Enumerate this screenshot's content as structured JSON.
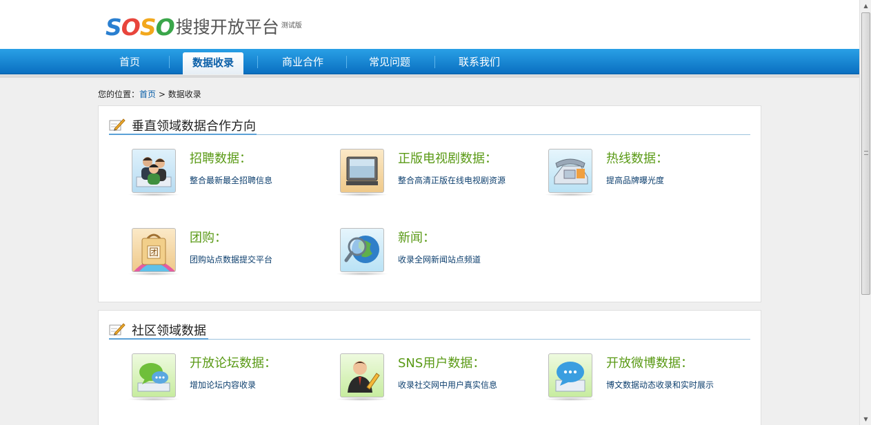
{
  "header": {
    "logo_text": [
      "S",
      "O",
      "S",
      "O"
    ],
    "logo_cn": "搜搜开放平台",
    "logo_beta": "测试版"
  },
  "nav": {
    "items": [
      "首页",
      "数据收录",
      "商业合作",
      "常见问题",
      "联系我们"
    ],
    "active": "数据收录"
  },
  "breadcrumb": {
    "label": "您的位置：",
    "home": "首页",
    "separator": ">",
    "current": "数据收录"
  },
  "sections": [
    {
      "title": "垂直领域数据合作方向",
      "items": [
        {
          "title": "招聘数据：",
          "desc": "整合最新最全招聘信息",
          "icon": "people-icon"
        },
        {
          "title": "正版电视剧数据：",
          "desc": "整合高清正版在线电视剧资源",
          "icon": "tv-icon"
        },
        {
          "title": "热线数据：",
          "desc": "提高品牌曝光度",
          "icon": "telephone-icon"
        },
        {
          "title": "团购：",
          "desc": "团购站点数据提交平台",
          "icon": "shopping-bag-icon"
        },
        {
          "title": "新闻：",
          "desc": "收录全网新闻站点频道",
          "icon": "globe-magnifier-icon"
        }
      ]
    },
    {
      "title": "社区领域数据",
      "items": [
        {
          "title": "开放论坛数据：",
          "desc": "增加论坛内容收录",
          "icon": "chat-bubbles-icon"
        },
        {
          "title": "SNS用户数据：",
          "desc": "收录社交网中用户真实信息",
          "icon": "user-pen-icon"
        },
        {
          "title": "开放微博数据：",
          "desc": "博文数据动态收录和实时展示",
          "icon": "speech-bubble-icon"
        }
      ]
    }
  ],
  "colors": {
    "nav_top": "#29a0e6",
    "nav_bottom": "#0a6fc0",
    "item_title": "#5a9a16",
    "item_desc": "#0d3f6e"
  }
}
